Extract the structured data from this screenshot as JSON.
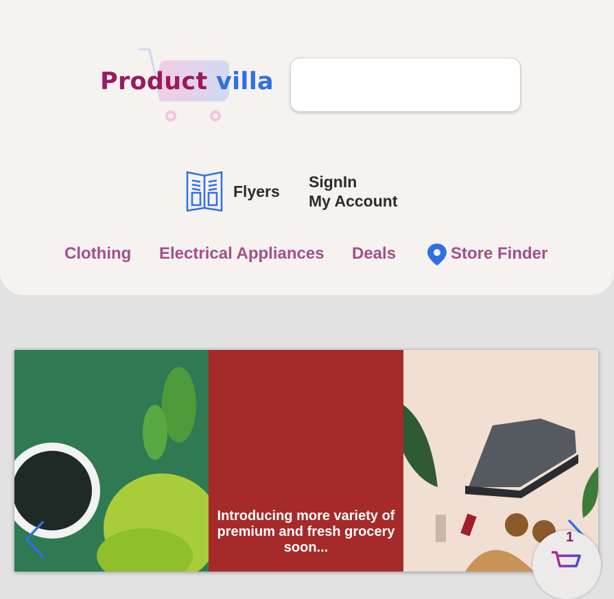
{
  "logo": {
    "part1": "Product",
    "part2": "villa"
  },
  "search": {
    "placeholder": "",
    "value": ""
  },
  "header_links": {
    "flyers": "Flyers",
    "signin": "SignIn",
    "my_account": "My Account"
  },
  "nav": {
    "clothing": "Clothing",
    "electrical": "Electrical Appliances",
    "deals": "Deals",
    "store_finder": "Store Finder"
  },
  "carousel": {
    "promo_text": "Introducing more variety of premium and fresh grocery soon..."
  },
  "cart": {
    "count": "1"
  },
  "colors": {
    "brand": "#9a1a5e",
    "accent": "#2e6fe6",
    "nav": "#a34f8a",
    "promo_bg": "#a62a2a"
  }
}
